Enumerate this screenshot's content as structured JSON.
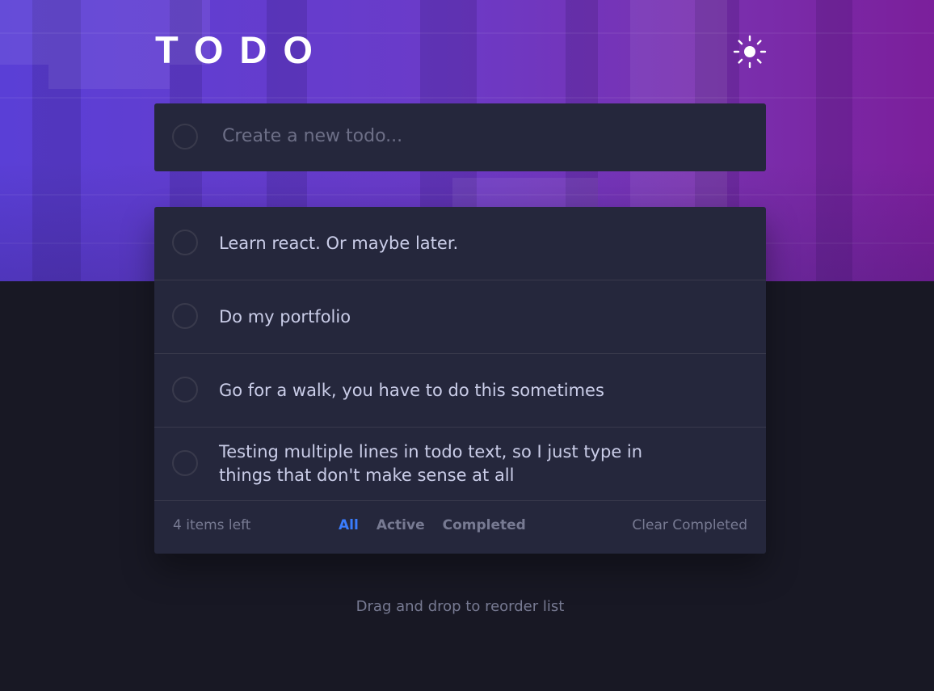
{
  "app": {
    "title": "TODO",
    "theme_toggle_icon": "sun-icon"
  },
  "new_todo": {
    "placeholder": "Create a new todo...",
    "value": ""
  },
  "todos": [
    {
      "text": "Learn react. Or maybe later.",
      "completed": false
    },
    {
      "text": "Do my portfolio",
      "completed": false
    },
    {
      "text": "Go for a walk, you have to do this sometimes",
      "completed": false
    },
    {
      "text": "Testing multiple lines in todo text, so I just type in things that don't make sense at all",
      "completed": false
    }
  ],
  "footer": {
    "items_left": "4 items left",
    "filters": [
      "All",
      "Active",
      "Completed"
    ],
    "active_filter": "All",
    "clear_label": "Clear Completed"
  },
  "hint": "Drag and drop to reorder list",
  "colors": {
    "page_bg": "#181824",
    "card_bg": "#25273c",
    "accent": "#3a7cfd",
    "text": "#cacde8",
    "muted": "#777a92",
    "hero_left": "#5a3fd6",
    "hero_right": "#7b1f9b"
  }
}
